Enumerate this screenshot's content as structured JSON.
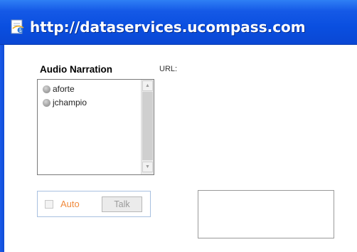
{
  "window": {
    "title": "http://dataservices.ucompass.com",
    "icon": "ie-page-icon"
  },
  "audio_narration": {
    "title": "Audio Narration",
    "url_label": "URL:",
    "users": [
      {
        "name": "aforte",
        "status": "offline"
      },
      {
        "name": "jchampio",
        "status": "offline"
      }
    ],
    "auto_label": "Auto",
    "auto_checked": false,
    "talk_label": "Talk"
  },
  "colors": {
    "title_bar": "#0a4fe0",
    "auto_text": "#f08a3c",
    "disabled_text": "#9a9a9a"
  }
}
